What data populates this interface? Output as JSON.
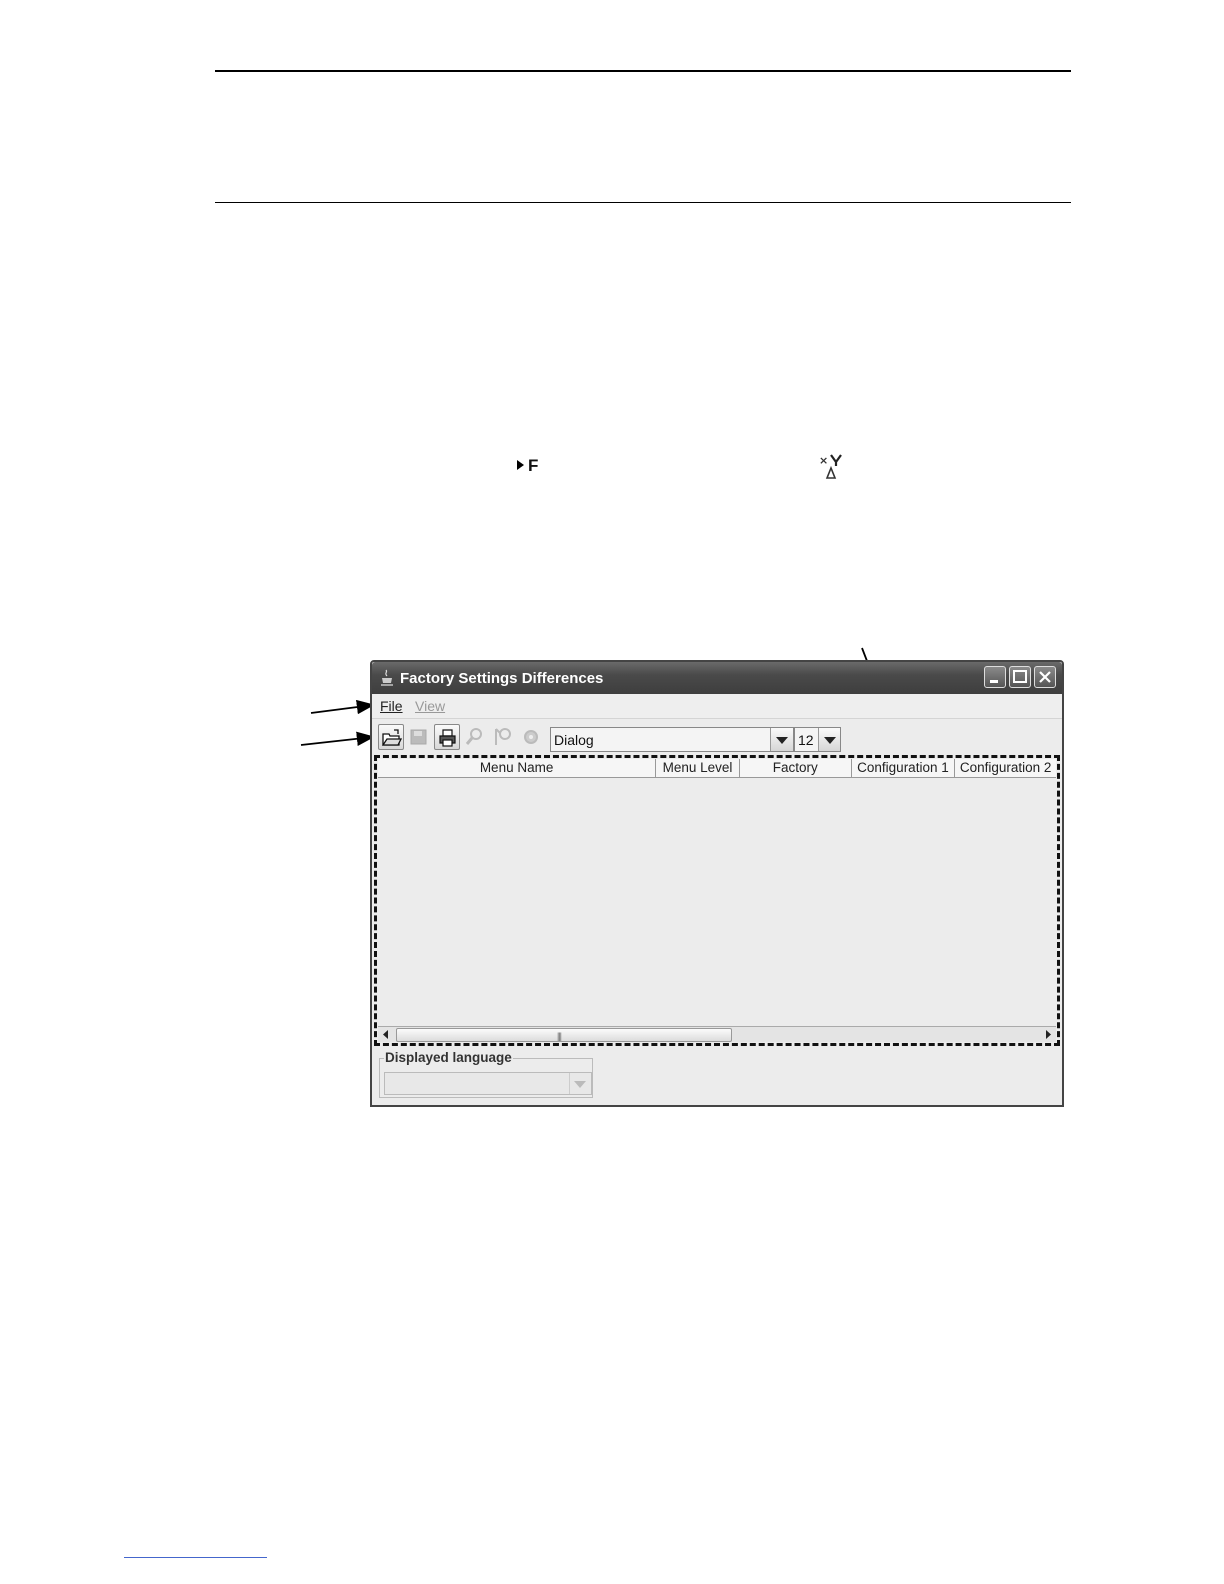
{
  "window": {
    "title": "Factory Settings Differences"
  },
  "inline_text": {
    "marker_label": "F"
  },
  "menubar": {
    "file_label": "File",
    "view_label": "View"
  },
  "toolbar": {
    "font_value": "Dialog",
    "size_value": "12",
    "icons": [
      "open-folder-icon",
      "save-icon",
      "print-icon",
      "find-icon",
      "find-next-icon",
      "refresh-icon"
    ]
  },
  "table": {
    "columns": [
      "Menu Name",
      "Menu Level",
      "Factory",
      "Configuration 1",
      "Configuration 2"
    ],
    "rows": []
  },
  "language": {
    "legend": "Displayed language",
    "value": ""
  }
}
